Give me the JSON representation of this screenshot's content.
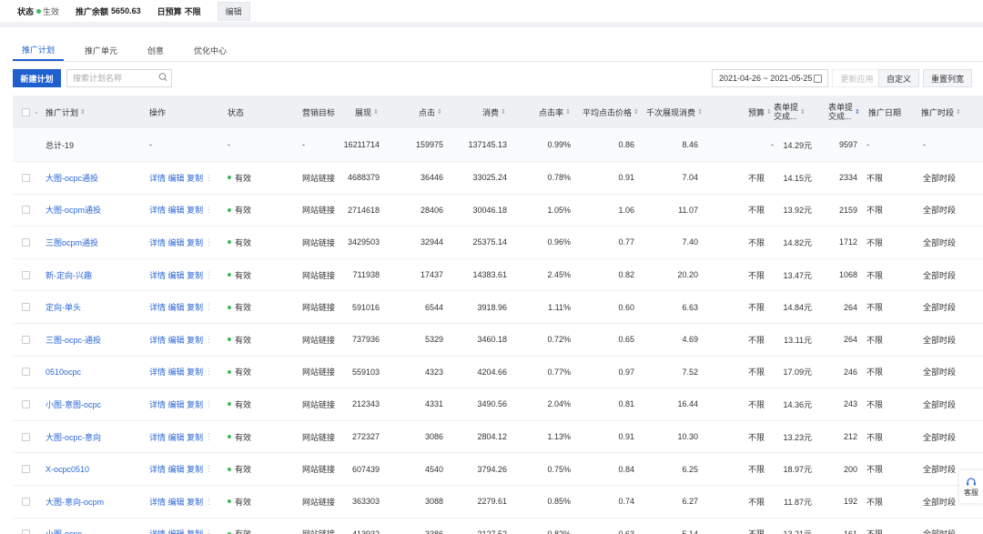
{
  "topbar": {
    "status_label": "状态",
    "status_value": "生效",
    "balance_label": "推广余额",
    "balance_value": "5650.63",
    "budget_label": "日预算",
    "budget_value": "不限",
    "edit": "编辑"
  },
  "tabs": [
    "推广计划",
    "推广单元",
    "创意",
    "优化中心"
  ],
  "toolbar": {
    "new_plan": "新建计划",
    "search_placeholder": "搜索计划名称",
    "date_range": "2021-04-26 ~ 2021-05-25",
    "update_apply": "更新应用",
    "customize": "自定义",
    "reset_columns": "重置列宽"
  },
  "columns": {
    "plan": "推广计划",
    "op": "操作",
    "status": "状态",
    "goal": "营销目标",
    "impr": "展现",
    "clicks": "点击",
    "cost": "消费",
    "ctr": "点击率",
    "cpc": "平均点击价格",
    "cpm": "千次展现消费",
    "budget": "预算",
    "form_cost_1": "表单提",
    "form_cost_2": "交成...",
    "form_cnt_1": "表单提",
    "form_cnt_2": "交成...",
    "date": "推广日期",
    "period": "推广时段"
  },
  "total": {
    "name": "总计-19",
    "op": "-",
    "status": "-",
    "goal": "-",
    "impr": "16211714",
    "clicks": "159975",
    "cost": "137145.13",
    "ctr": "0.99%",
    "cpc": "0.86",
    "cpm": "8.46",
    "budget": "-",
    "form_cost": "14.29元",
    "form_cnt": "9597",
    "date": "-",
    "period": "-"
  },
  "row_common": {
    "op_detail": "详情",
    "op_edit": "编辑",
    "op_copy": "复制",
    "op_more": "⋮",
    "status": "有效",
    "goal": "网站链接",
    "budget": "不限",
    "date": "不限",
    "period": "全部时段"
  },
  "rows": [
    {
      "name": "大图-ocpc通投",
      "impr": "4688379",
      "clicks": "36446",
      "cost": "33025.24",
      "ctr": "0.78%",
      "cpc": "0.91",
      "cpm": "7.04",
      "form_cost": "14.15元",
      "form_cnt": "2334"
    },
    {
      "name": "大图-ocpm通投",
      "impr": "2714618",
      "clicks": "28406",
      "cost": "30046.18",
      "ctr": "1.05%",
      "cpc": "1.06",
      "cpm": "11.07",
      "form_cost": "13.92元",
      "form_cnt": "2159"
    },
    {
      "name": "三图ocpm通投",
      "impr": "3429503",
      "clicks": "32944",
      "cost": "25375.14",
      "ctr": "0.96%",
      "cpc": "0.77",
      "cpm": "7.40",
      "form_cost": "14.82元",
      "form_cnt": "1712"
    },
    {
      "name": "新-定向-兴趣",
      "impr": "711938",
      "clicks": "17437",
      "cost": "14383.61",
      "ctr": "2.45%",
      "cpc": "0.82",
      "cpm": "20.20",
      "form_cost": "13.47元",
      "form_cnt": "1068"
    },
    {
      "name": "定向-单头",
      "impr": "591016",
      "clicks": "6544",
      "cost": "3918.96",
      "ctr": "1.11%",
      "cpc": "0.60",
      "cpm": "6.63",
      "form_cost": "14.84元",
      "form_cnt": "264"
    },
    {
      "name": "三图-ocpc-通投",
      "impr": "737936",
      "clicks": "5329",
      "cost": "3460.18",
      "ctr": "0.72%",
      "cpc": "0.65",
      "cpm": "4.69",
      "form_cost": "13.11元",
      "form_cnt": "264"
    },
    {
      "name": "0510ocpc",
      "impr": "559103",
      "clicks": "4323",
      "cost": "4204.66",
      "ctr": "0.77%",
      "cpc": "0.97",
      "cpm": "7.52",
      "form_cost": "17.09元",
      "form_cnt": "246"
    },
    {
      "name": "小图-意图-ocpc",
      "impr": "212343",
      "clicks": "4331",
      "cost": "3490.56",
      "ctr": "2.04%",
      "cpc": "0.81",
      "cpm": "16.44",
      "form_cost": "14.36元",
      "form_cnt": "243"
    },
    {
      "name": "大图-ocpc-意向",
      "impr": "272327",
      "clicks": "3086",
      "cost": "2804.12",
      "ctr": "1.13%",
      "cpc": "0.91",
      "cpm": "10.30",
      "form_cost": "13.23元",
      "form_cnt": "212"
    },
    {
      "name": "X-ocpc0510",
      "impr": "607439",
      "clicks": "4540",
      "cost": "3794.26",
      "ctr": "0.75%",
      "cpc": "0.84",
      "cpm": "6.25",
      "form_cost": "18.97元",
      "form_cnt": "200"
    },
    {
      "name": "大图-意向-ocpm",
      "impr": "363303",
      "clicks": "3088",
      "cost": "2279.61",
      "ctr": "0.85%",
      "cpc": "0.74",
      "cpm": "6.27",
      "form_cost": "11.87元",
      "form_cnt": "192"
    },
    {
      "name": "小图-ocpc",
      "impr": "413932",
      "clicks": "3386",
      "cost": "2127.52",
      "ctr": "0.82%",
      "cpc": "0.63",
      "cpm": "5.14",
      "form_cost": "13.21元",
      "form_cnt": "161"
    }
  ],
  "service": {
    "label": "客服"
  },
  "colors": {
    "accent": "#1f5fce",
    "link": "#2a66d6",
    "status_green": "#3dbb5b"
  }
}
